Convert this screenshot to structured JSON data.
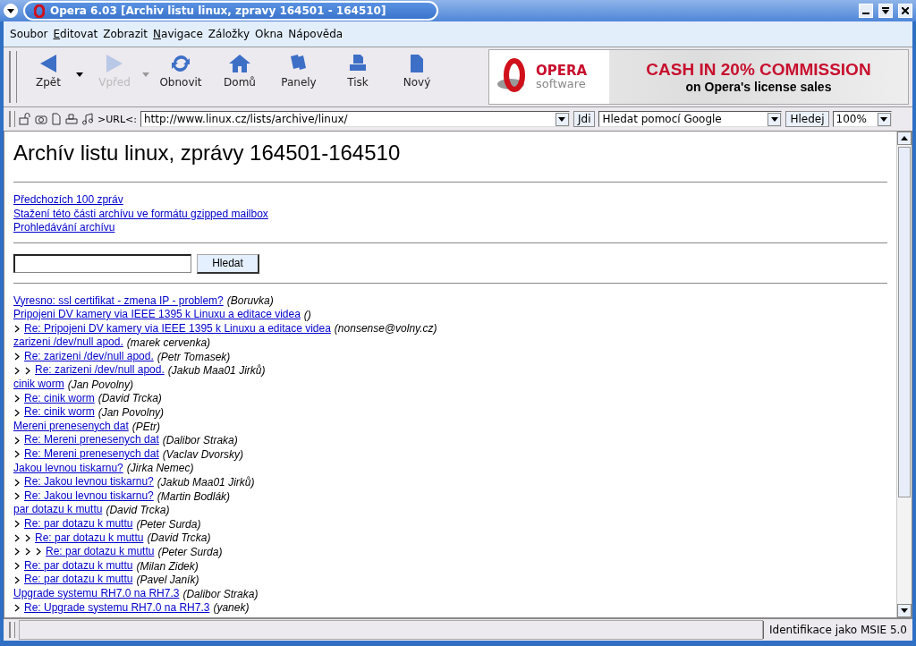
{
  "window": {
    "title": "Opera 6.03  [Archiv listu linux, zpravy 164501 - 164510]"
  },
  "menu": [
    {
      "label": "Soubor",
      "accel": false
    },
    {
      "label": "Editovat",
      "accel": true
    },
    {
      "label": "Zobrazit",
      "accel": false
    },
    {
      "label": "Navigace",
      "accel": true
    },
    {
      "label": "Záložky",
      "accel": false
    },
    {
      "label": "Okna",
      "accel": false
    },
    {
      "label": "Nápověda",
      "accel": false
    }
  ],
  "toolbar": [
    {
      "kind": "back",
      "label": "Zpět",
      "disabled": false,
      "dropdown": true
    },
    {
      "kind": "forward",
      "label": "Vpřed",
      "disabled": true,
      "dropdown": true
    },
    {
      "kind": "reload",
      "label": "Obnovit",
      "disabled": false,
      "dropdown": false
    },
    {
      "kind": "home",
      "label": "Domů",
      "disabled": false,
      "dropdown": false
    },
    {
      "kind": "panels",
      "label": "Panely",
      "disabled": false,
      "dropdown": false
    },
    {
      "kind": "print",
      "label": "Tisk",
      "disabled": false,
      "dropdown": false
    },
    {
      "kind": "new",
      "label": "Nový",
      "disabled": false,
      "dropdown": false
    }
  ],
  "banner": {
    "logo_word": "OPERA",
    "logo_sub": "software",
    "headline": "CASH IN 20% COMMISSION",
    "subline": "on Opera's license sales"
  },
  "address_bar": {
    "url_label": ">URL<:",
    "url": "http://www.linux.cz/lists/archive/linux/",
    "go": "Jdi",
    "search_engine": "Hledat pomocí Google",
    "search_button": "Hledej",
    "zoom": "100%"
  },
  "page": {
    "heading": "Archív listu linux, zprávy 164501-164510",
    "links": [
      "Předchozích 100 zpráv",
      "Stažení této části archívu ve formátu gzipped mailbox",
      "Prohledávání archívu"
    ],
    "search_button": "Hledat",
    "threads": [
      {
        "subject": "Vyresno: ssl certifikat - zmena IP - problem?",
        "author": "(Boruvka)"
      },
      {
        "subject": "Pripojeni DV kamery via IEEE 1395 k Linuxu a editace videa",
        "author": "()",
        "children": [
          {
            "subject": "Re: Pripojeni DV kamery via IEEE 1395 k Linuxu a editace videa",
            "author": "(nonsense@volny.cz)"
          }
        ]
      },
      {
        "subject": "zarizeni /dev/null apod.",
        "author": "(marek cervenka)",
        "children": [
          {
            "subject": "Re: zarizeni /dev/null apod.",
            "author": "(Petr Tomasek)",
            "children": [
              {
                "subject": "Re: zarizeni /dev/null apod.",
                "author": "(Jakub Maa01 Jirků)"
              }
            ]
          }
        ]
      },
      {
        "subject": "cinik worm",
        "author": "(Jan Povolny)",
        "children": [
          {
            "subject": "Re: cinik worm",
            "author": "(David Trcka)"
          },
          {
            "subject": "Re: cinik worm",
            "author": "(Jan Povolny)"
          }
        ]
      },
      {
        "subject": "Mereni prenesenych dat",
        "author": "(PEtr)",
        "children": [
          {
            "subject": "Re: Mereni prenesenych dat",
            "author": "(Dalibor Straka)"
          },
          {
            "subject": "Re: Mereni prenesenych dat",
            "author": "(Vaclav Dvorsky)"
          }
        ]
      },
      {
        "subject": "Jakou levnou tiskarnu?",
        "author": "(Jirka Nemec)",
        "children": [
          {
            "subject": "Re: Jakou levnou tiskarnu?",
            "author": "(Jakub Maa01 Jirků)"
          },
          {
            "subject": "Re: Jakou levnou tiskarnu?",
            "author": "(Martin Bodlák)"
          }
        ]
      },
      {
        "subject": "par dotazu k muttu",
        "author": "(David Trcka)",
        "children": [
          {
            "subject": "Re: par dotazu k muttu",
            "author": "(Peter Surda)",
            "children": [
              {
                "subject": "Re: par dotazu k muttu",
                "author": "(David Trcka)",
                "children": [
                  {
                    "subject": "Re: par dotazu k muttu",
                    "author": "(Peter Surda)"
                  }
                ]
              }
            ]
          },
          {
            "subject": "Re: par dotazu k muttu",
            "author": "(Milan Zidek)"
          },
          {
            "subject": "Re: par dotazu k muttu",
            "author": "(Pavel Janík)"
          }
        ]
      },
      {
        "subject": "Upgrade systemu RH7.0 na RH7.3",
        "author": "(Dalibor Straka)",
        "children": [
          {
            "subject": "Re: Upgrade systemu RH7.0 na RH7.3",
            "author": "(yanek)"
          }
        ]
      }
    ]
  },
  "status_bar": {
    "identity": "Identifikace jako MSIE 5.0"
  }
}
